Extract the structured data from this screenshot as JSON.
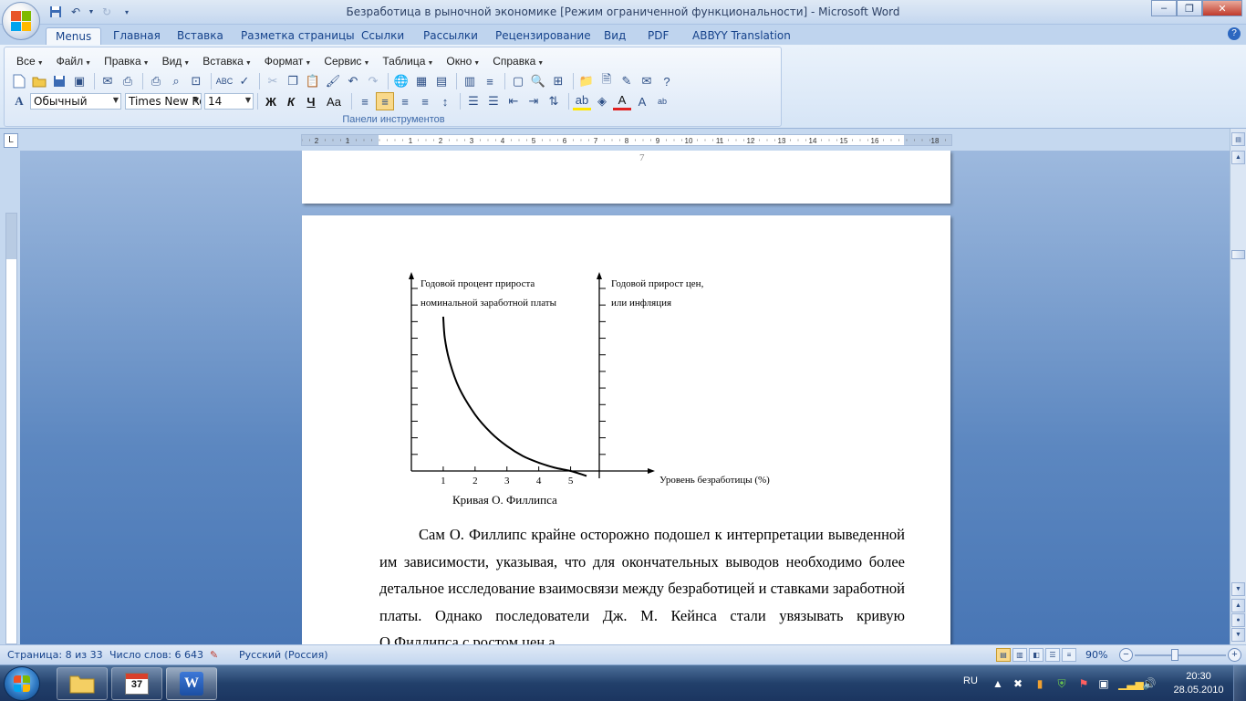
{
  "window": {
    "title": "Безработица в рыночной экономике [Режим ограниченной функциональности] - Microsoft Word",
    "minimize": "–",
    "maximize": "❐",
    "close": "✕"
  },
  "ribbon_tabs": [
    "Menus",
    "Главная",
    "Вставка",
    "Разметка страницы",
    "Ссылки",
    "Рассылки",
    "Рецензирование",
    "Вид",
    "PDF",
    "ABBYY Translation"
  ],
  "menus": [
    "Все",
    "Файл",
    "Правка",
    "Вид",
    "Вставка",
    "Формат",
    "Сервис",
    "Таблица",
    "Окно",
    "Справка"
  ],
  "formatting": {
    "style": "Обычный",
    "font": "Times New Ro",
    "size": "14",
    "bold": "Ж",
    "italic": "К",
    "underline": "Ч",
    "case": "Аа"
  },
  "panel_label": "Панели инструментов",
  "ruler": {
    "tab_selector": "L",
    "labels": [
      "2",
      "1",
      "1",
      "2",
      "3",
      "4",
      "5",
      "6",
      "7",
      "8",
      "9",
      "10",
      "11",
      "12",
      "13",
      "14",
      "15",
      "16",
      "18"
    ]
  },
  "document": {
    "prev_page_number": "7",
    "chart_left_axis_label_1": "Годовой  процент  прироста",
    "chart_left_axis_label_2": "номинальной заработной  платы",
    "chart_right_axis_label_1": "Годовой  прирост  цен,",
    "chart_right_axis_label_2": "или  инфляция",
    "chart_x_axis_label": "Уровень безработицы (%)",
    "caption": "Кривая  О. Филлипса",
    "paragraph": "Сам О. Филлипс крайне осторожно подошел к интерпретации выведенной им зависимости, указывая, что для окончательных выводов необходимо более детальное исследование взаимосвязи между безработицей и ставками заработной платы. Однако последователи Дж. М. Кейнса стали увязывать кривую О.Филлипса с ростом цен а"
  },
  "chart_data": {
    "type": "line",
    "title": "",
    "xlabel": "Уровень безработицы (%)",
    "ylabel": "Годовой процент прироста номинальной заработной платы",
    "y2label": "Годовой прирост цен, или инфляция",
    "x_ticks": [
      "1",
      "2",
      "3",
      "4",
      "5"
    ],
    "xlim": [
      0,
      5.9
    ],
    "ylim": [
      0,
      11
    ],
    "series": [
      {
        "x": [
          1.0,
          1.05,
          1.2,
          1.5,
          2.0,
          2.5,
          3.0,
          3.5,
          4.0,
          4.5,
          5.0,
          5.5
        ],
        "y": [
          9.3,
          8.0,
          6.6,
          5.0,
          3.4,
          2.3,
          1.5,
          0.9,
          0.5,
          0.2,
          0.0,
          -0.3
        ]
      }
    ],
    "grid": false
  },
  "status": {
    "page": "Страница: 8 из 33",
    "words": "Число слов: 6 643",
    "language": "Русский (Россия)",
    "zoom": "90%",
    "zoom_level_percent": 90
  },
  "taskbar": {
    "lang": "RU",
    "time": "20:30",
    "date": "28.05.2010",
    "badge": "37"
  }
}
